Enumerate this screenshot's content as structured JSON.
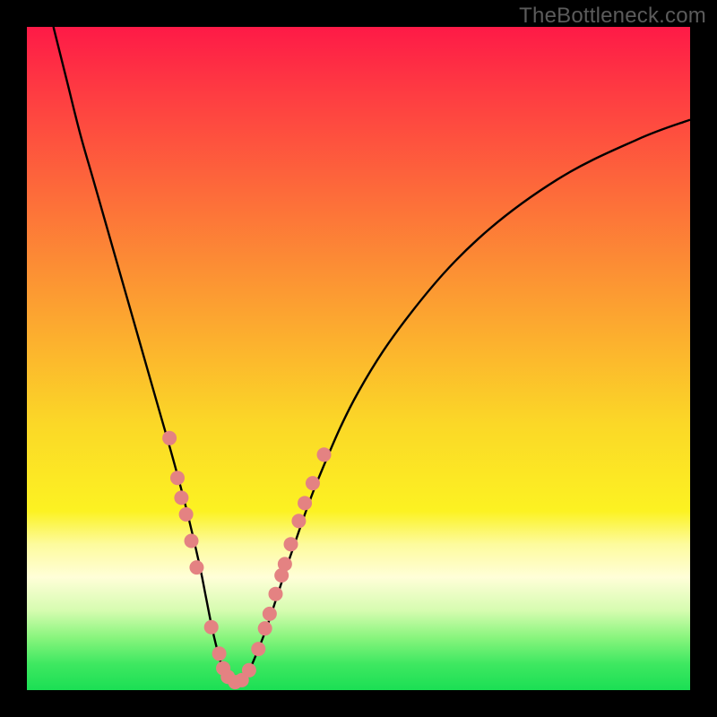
{
  "watermark_text": "TheBottleneck.com",
  "chart_data": {
    "type": "line",
    "title": "",
    "xlabel": "",
    "ylabel": "",
    "xlim": [
      0,
      100
    ],
    "ylim": [
      0,
      100
    ],
    "grid": false,
    "series": [
      {
        "name": "bottleneck-curve",
        "color": "#000000",
        "x": [
          4,
          6,
          8,
          10,
          12,
          14,
          16,
          18,
          20,
          22,
          24,
          26,
          27,
          28,
          29,
          30,
          31,
          32,
          33,
          34,
          36,
          38,
          40,
          44,
          50,
          58,
          68,
          80,
          92,
          100
        ],
        "y": [
          100,
          92,
          84,
          77,
          70,
          63,
          56,
          49,
          42,
          35,
          27.5,
          19,
          14,
          9,
          5,
          2,
          1,
          1,
          2,
          4,
          9,
          15,
          21,
          32,
          45,
          57,
          68,
          77,
          83,
          86
        ]
      }
    ],
    "markers": [
      {
        "name": "data-points",
        "color": "#e48282",
        "radius_px": 8,
        "points": [
          {
            "x": 21.5,
            "y": 38
          },
          {
            "x": 22.7,
            "y": 32
          },
          {
            "x": 23.3,
            "y": 29
          },
          {
            "x": 24.0,
            "y": 26.5
          },
          {
            "x": 24.8,
            "y": 22.5
          },
          {
            "x": 25.6,
            "y": 18.5
          },
          {
            "x": 27.8,
            "y": 9.5
          },
          {
            "x": 29.0,
            "y": 5.5
          },
          {
            "x": 29.6,
            "y": 3.3
          },
          {
            "x": 30.3,
            "y": 2.0
          },
          {
            "x": 31.4,
            "y": 1.2
          },
          {
            "x": 32.4,
            "y": 1.5
          },
          {
            "x": 33.5,
            "y": 3.0
          },
          {
            "x": 34.9,
            "y": 6.2
          },
          {
            "x": 35.9,
            "y": 9.3
          },
          {
            "x": 36.6,
            "y": 11.5
          },
          {
            "x": 37.5,
            "y": 14.5
          },
          {
            "x": 38.4,
            "y": 17.3
          },
          {
            "x": 38.9,
            "y": 19.0
          },
          {
            "x": 39.8,
            "y": 22.0
          },
          {
            "x": 41.0,
            "y": 25.5
          },
          {
            "x": 41.9,
            "y": 28.2
          },
          {
            "x": 43.1,
            "y": 31.2
          },
          {
            "x": 44.8,
            "y": 35.5
          }
        ]
      }
    ],
    "background_gradient_stops": [
      {
        "pos": 0.0,
        "color": "#fe1a47"
      },
      {
        "pos": 0.1,
        "color": "#fe3c42"
      },
      {
        "pos": 0.25,
        "color": "#fd6b3a"
      },
      {
        "pos": 0.42,
        "color": "#fca031"
      },
      {
        "pos": 0.6,
        "color": "#fbd827"
      },
      {
        "pos": 0.73,
        "color": "#fcf222"
      },
      {
        "pos": 0.78,
        "color": "#fdfb9d"
      },
      {
        "pos": 0.83,
        "color": "#fffed8"
      },
      {
        "pos": 0.88,
        "color": "#d6fcb0"
      },
      {
        "pos": 0.92,
        "color": "#8af57e"
      },
      {
        "pos": 0.96,
        "color": "#3fe861"
      },
      {
        "pos": 1.0,
        "color": "#1bdf54"
      }
    ]
  }
}
